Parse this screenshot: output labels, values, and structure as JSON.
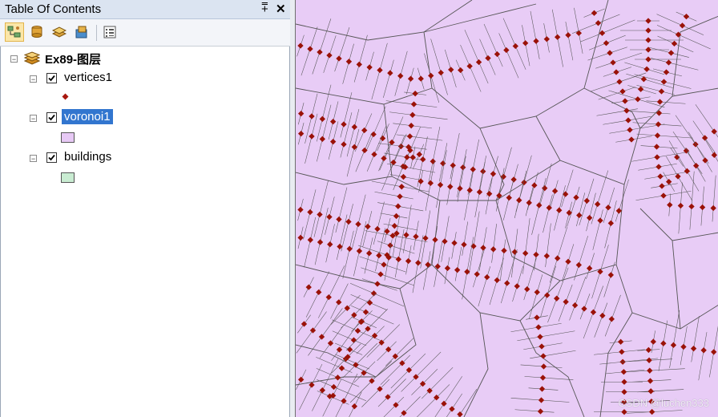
{
  "toc": {
    "title": "Table Of Contents",
    "pin_glyph": "⩱",
    "close_glyph": "✕",
    "toolbar": [
      {
        "name": "list-by-drawing-order-icon",
        "active": true
      },
      {
        "name": "list-by-source-icon",
        "active": false
      },
      {
        "name": "list-by-visibility-icon",
        "active": false
      },
      {
        "name": "list-by-selection-icon",
        "active": false
      },
      {
        "name": "options-icon",
        "active": false
      }
    ]
  },
  "tree": {
    "data_frame": {
      "label": "Ex89-图层",
      "expanded_glyph": "−"
    },
    "layers": [
      {
        "label": "vertices1",
        "checked": true,
        "selected": false,
        "symbol": "point",
        "symbol_color": "#a8180f"
      },
      {
        "label": "voronoi1",
        "checked": true,
        "selected": true,
        "symbol": "polygon",
        "symbol_color": "#e7c9f5"
      },
      {
        "label": "buildings",
        "checked": true,
        "selected": false,
        "symbol": "polygon",
        "symbol_color": "#c9ecd2"
      }
    ]
  },
  "map": {
    "fill_color": "#e8ccf6",
    "edge_color": "#555555",
    "vertex_color": "#9a1208",
    "watermark": "CSDN @luchen333"
  }
}
